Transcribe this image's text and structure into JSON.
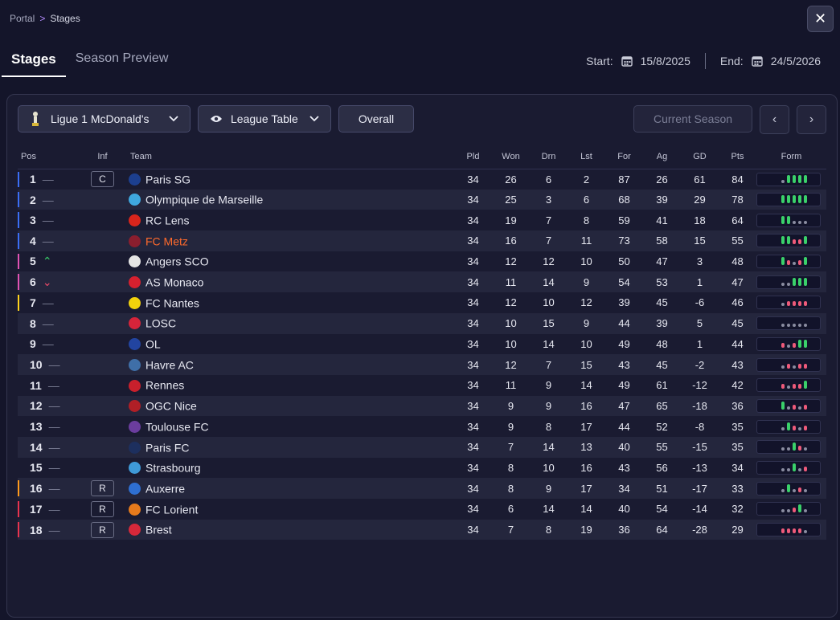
{
  "breadcrumb": {
    "parent": "Portal",
    "current": "Stages"
  },
  "tabs": [
    {
      "label": "Stages"
    },
    {
      "label": "Season Preview"
    }
  ],
  "dates": {
    "start_label": "Start:",
    "start": "15/8/2025",
    "end_label": "End:",
    "end": "24/5/2026"
  },
  "toolbar": {
    "league": "Ligue 1 McDonald's",
    "view": "League Table",
    "overall": "Overall",
    "current_season": "Current Season"
  },
  "columns": [
    "Pos",
    "Inf",
    "Team",
    "Pld",
    "Won",
    "Drn",
    "Lst",
    "For",
    "Ag",
    "GD",
    "Pts",
    "Form"
  ],
  "colors": {
    "accent": "#ff6a2c",
    "champions": "#3b6ef5",
    "europa": "#e052b4",
    "conference": "#ffd21c",
    "playoff": "#ff9a1c",
    "relegation": "#e8334f",
    "win": "#3ad16a",
    "loss": "#ef5a7a"
  },
  "rows": [
    {
      "pos": "1",
      "trend": "same",
      "inf": "C",
      "team": "Paris SG",
      "crest": "#1c3f8f",
      "pld": "34",
      "won": "26",
      "drn": "6",
      "lst": "2",
      "for": "87",
      "ag": "26",
      "gd": "61",
      "pts": "84",
      "zone": "#3b6ef5",
      "form": [
        "D",
        "W",
        "W",
        "W",
        "W"
      ]
    },
    {
      "pos": "2",
      "trend": "same",
      "inf": "",
      "team": "Olympique de Marseille",
      "crest": "#3fa8df",
      "pld": "34",
      "won": "25",
      "drn": "3",
      "lst": "6",
      "for": "68",
      "ag": "39",
      "gd": "29",
      "pts": "78",
      "zone": "#3b6ef5",
      "form": [
        "W",
        "W",
        "W",
        "W",
        "W"
      ]
    },
    {
      "pos": "3",
      "trend": "same",
      "inf": "",
      "team": "RC Lens",
      "crest": "#d8251c",
      "pld": "34",
      "won": "19",
      "drn": "7",
      "lst": "8",
      "for": "59",
      "ag": "41",
      "gd": "18",
      "pts": "64",
      "zone": "#3b6ef5",
      "form": [
        "W",
        "W",
        "D",
        "D",
        "D"
      ]
    },
    {
      "pos": "4",
      "trend": "same",
      "inf": "",
      "team": "FC Metz",
      "crest": "#8b1e2e",
      "pld": "34",
      "won": "16",
      "drn": "7",
      "lst": "11",
      "for": "73",
      "ag": "58",
      "gd": "15",
      "pts": "55",
      "zone": "#3b6ef5",
      "mine": true,
      "form": [
        "W",
        "W",
        "L",
        "L",
        "W"
      ]
    },
    {
      "pos": "5",
      "trend": "up",
      "inf": "",
      "team": "Angers SCO",
      "crest": "#e5e5e5",
      "pld": "34",
      "won": "12",
      "drn": "12",
      "lst": "10",
      "for": "50",
      "ag": "47",
      "gd": "3",
      "pts": "48",
      "zone": "#e052b4",
      "form": [
        "W",
        "L",
        "D",
        "L",
        "W"
      ]
    },
    {
      "pos": "6",
      "trend": "down",
      "inf": "",
      "team": "AS Monaco",
      "crest": "#d6202f",
      "pld": "34",
      "won": "11",
      "drn": "14",
      "lst": "9",
      "for": "54",
      "ag": "53",
      "gd": "1",
      "pts": "47",
      "zone": "#e052b4",
      "form": [
        "D",
        "D",
        "W",
        "W",
        "W"
      ]
    },
    {
      "pos": "7",
      "trend": "same",
      "inf": "",
      "team": "FC Nantes",
      "crest": "#f2d20c",
      "pld": "34",
      "won": "12",
      "drn": "10",
      "lst": "12",
      "for": "39",
      "ag": "45",
      "gd": "-6",
      "pts": "46",
      "zone": "#ffd21c",
      "form": [
        "D",
        "L",
        "L",
        "L",
        "L"
      ]
    },
    {
      "pos": "8",
      "trend": "same",
      "inf": "",
      "team": "LOSC",
      "crest": "#d6243a",
      "pld": "34",
      "won": "10",
      "drn": "15",
      "lst": "9",
      "for": "44",
      "ag": "39",
      "gd": "5",
      "pts": "45",
      "zone": "",
      "form": [
        "D",
        "D",
        "D",
        "D",
        "D"
      ]
    },
    {
      "pos": "9",
      "trend": "same",
      "inf": "",
      "team": "OL",
      "crest": "#2244a0",
      "pld": "34",
      "won": "10",
      "drn": "14",
      "lst": "10",
      "for": "49",
      "ag": "48",
      "gd": "1",
      "pts": "44",
      "zone": "",
      "form": [
        "L",
        "D",
        "L",
        "W",
        "W"
      ]
    },
    {
      "pos": "10",
      "trend": "same",
      "inf": "",
      "team": "Havre AC",
      "crest": "#3f6fa8",
      "pld": "34",
      "won": "12",
      "drn": "7",
      "lst": "15",
      "for": "43",
      "ag": "45",
      "gd": "-2",
      "pts": "43",
      "zone": "",
      "form": [
        "D",
        "L",
        "D",
        "L",
        "L"
      ]
    },
    {
      "pos": "11",
      "trend": "same",
      "inf": "",
      "team": "Rennes",
      "crest": "#c9202c",
      "pld": "34",
      "won": "11",
      "drn": "9",
      "lst": "14",
      "for": "49",
      "ag": "61",
      "gd": "-12",
      "pts": "42",
      "zone": "",
      "form": [
        "L",
        "D",
        "L",
        "L",
        "W"
      ]
    },
    {
      "pos": "12",
      "trend": "same",
      "inf": "",
      "team": "OGC Nice",
      "crest": "#b01f26",
      "pld": "34",
      "won": "9",
      "drn": "9",
      "lst": "16",
      "for": "47",
      "ag": "65",
      "gd": "-18",
      "pts": "36",
      "zone": "",
      "form": [
        "W",
        "D",
        "L",
        "D",
        "L"
      ]
    },
    {
      "pos": "13",
      "trend": "same",
      "inf": "",
      "team": "Toulouse FC",
      "crest": "#6b3d9e",
      "pld": "34",
      "won": "9",
      "drn": "8",
      "lst": "17",
      "for": "44",
      "ag": "52",
      "gd": "-8",
      "pts": "35",
      "zone": "",
      "form": [
        "D",
        "W",
        "L",
        "D",
        "L"
      ]
    },
    {
      "pos": "14",
      "trend": "same",
      "inf": "",
      "team": "Paris FC",
      "crest": "#1d2f5e",
      "pld": "34",
      "won": "7",
      "drn": "14",
      "lst": "13",
      "for": "40",
      "ag": "55",
      "gd": "-15",
      "pts": "35",
      "zone": "",
      "form": [
        "D",
        "D",
        "W",
        "L",
        "D"
      ]
    },
    {
      "pos": "15",
      "trend": "same",
      "inf": "",
      "team": "Strasbourg",
      "crest": "#3f9ad8",
      "pld": "34",
      "won": "8",
      "drn": "10",
      "lst": "16",
      "for": "43",
      "ag": "56",
      "gd": "-13",
      "pts": "34",
      "zone": "",
      "form": [
        "D",
        "D",
        "W",
        "D",
        "L"
      ]
    },
    {
      "pos": "16",
      "trend": "same",
      "inf": "R",
      "team": "Auxerre",
      "crest": "#2e6fd1",
      "pld": "34",
      "won": "8",
      "drn": "9",
      "lst": "17",
      "for": "34",
      "ag": "51",
      "gd": "-17",
      "pts": "33",
      "zone": "#ff9a1c",
      "form": [
        "D",
        "W",
        "D",
        "L",
        "D"
      ]
    },
    {
      "pos": "17",
      "trend": "same",
      "inf": "R",
      "team": "FC Lorient",
      "crest": "#e57a1c",
      "pld": "34",
      "won": "6",
      "drn": "14",
      "lst": "14",
      "for": "40",
      "ag": "54",
      "gd": "-14",
      "pts": "32",
      "zone": "#e8334f",
      "form": [
        "D",
        "D",
        "L",
        "W",
        "D"
      ]
    },
    {
      "pos": "18",
      "trend": "same",
      "inf": "R",
      "team": "Brest",
      "crest": "#d6283a",
      "pld": "34",
      "won": "7",
      "drn": "8",
      "lst": "19",
      "for": "36",
      "ag": "64",
      "gd": "-28",
      "pts": "29",
      "zone": "#e8334f",
      "form": [
        "L",
        "L",
        "L",
        "L",
        "D"
      ]
    }
  ]
}
